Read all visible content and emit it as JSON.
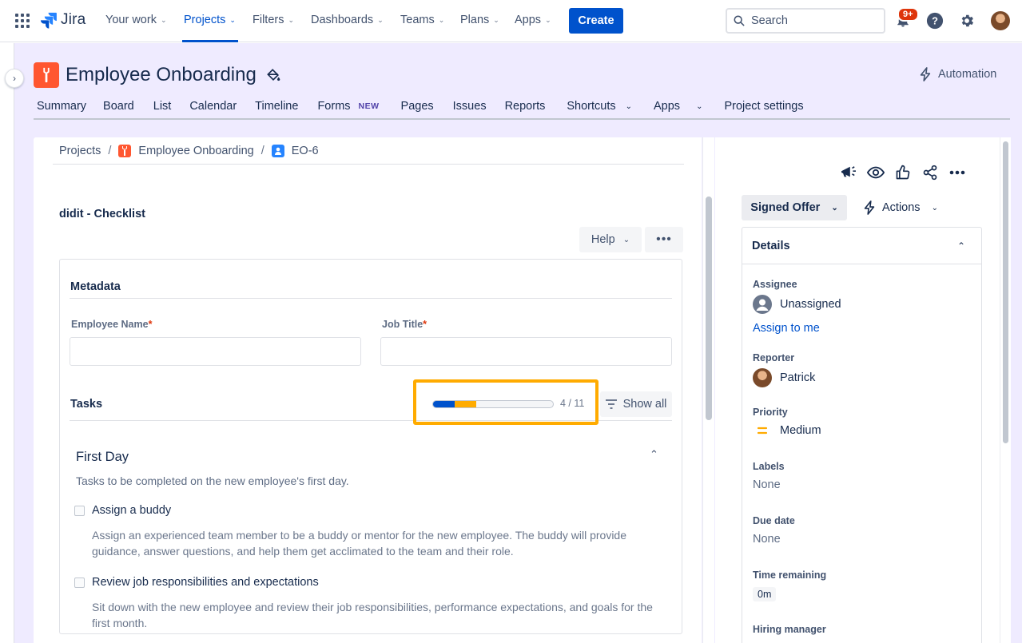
{
  "topnav": {
    "logo": "Jira",
    "items": [
      {
        "label": "Your work",
        "active": false
      },
      {
        "label": "Projects",
        "active": true
      },
      {
        "label": "Filters",
        "active": false
      },
      {
        "label": "Dashboards",
        "active": false
      },
      {
        "label": "Teams",
        "active": false
      },
      {
        "label": "Plans",
        "active": false
      },
      {
        "label": "Apps",
        "active": false
      }
    ],
    "create_label": "Create",
    "search_placeholder": "Search",
    "notification_badge": "9+"
  },
  "project": {
    "title": "Employee Onboarding",
    "automation_label": "Automation",
    "tabs": [
      {
        "label": "Summary"
      },
      {
        "label": "Board"
      },
      {
        "label": "List"
      },
      {
        "label": "Calendar"
      },
      {
        "label": "Timeline"
      },
      {
        "label": "Forms",
        "badge": "NEW"
      },
      {
        "label": "Pages"
      },
      {
        "label": "Issues"
      },
      {
        "label": "Reports"
      },
      {
        "label": "Shortcuts",
        "dropdown": true
      },
      {
        "label": "Apps",
        "dropdown": true
      },
      {
        "label": "Project settings"
      }
    ]
  },
  "breadcrumb": {
    "root": "Projects",
    "project": "Employee Onboarding",
    "issue": "EO-6"
  },
  "checklist": {
    "title": "didit - Checklist",
    "help_label": "Help",
    "more_label": "•••",
    "metadata_title": "Metadata",
    "fields": [
      {
        "label": "Employee Name",
        "value": ""
      },
      {
        "label": "Job Title",
        "value": ""
      }
    ],
    "required_mark": "*",
    "tasks_title": "Tasks",
    "progress": {
      "done": 2,
      "in_progress": 2,
      "total": 11,
      "text": "4 / 11"
    },
    "show_all_label": "Show all",
    "section": {
      "title": "First Day",
      "description": "Tasks to be completed on the new employee's first day.",
      "tasks": [
        {
          "title": "Assign a buddy",
          "checked": false,
          "description": "Assign an experienced team member to be a buddy or mentor for the new employee. The buddy will provide guidance, answer questions, and help them get acclimated to the team and their role."
        },
        {
          "title": "Review job responsibilities and expectations",
          "checked": false,
          "description": "Sit down with the new employee and review their job responsibilities, performance expectations, and goals for the first month."
        }
      ]
    }
  },
  "issue_panel": {
    "status_label": "Signed Offer",
    "actions_label": "Actions",
    "details_title": "Details",
    "assignee_label": "Assignee",
    "assignee_value": "Unassigned",
    "assign_to_me": "Assign to me",
    "reporter_label": "Reporter",
    "reporter_value": "Patrick",
    "priority_label": "Priority",
    "priority_value": "Medium",
    "labels_label": "Labels",
    "labels_value": "None",
    "due_label": "Due date",
    "due_value": "None",
    "time_label": "Time remaining",
    "time_value": "0m",
    "hiring_label": "Hiring manager"
  },
  "colors": {
    "brand": "#0052CC",
    "project_bg": "#EFEBFF",
    "highlight": "#FFAB00",
    "project_icon": "#FF5630"
  }
}
